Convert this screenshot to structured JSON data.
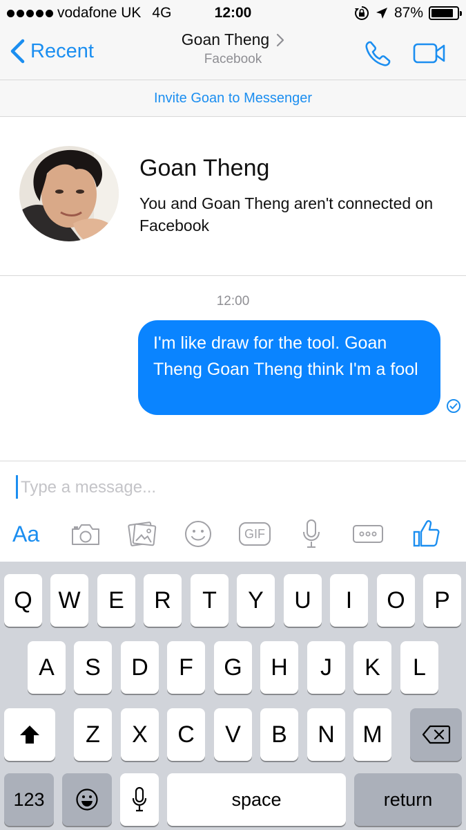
{
  "status_bar": {
    "carrier": "vodafone UK",
    "network": "4G",
    "time": "12:00",
    "battery_percent": "87%",
    "battery_level": 0.87,
    "icons": [
      "signal-dots",
      "rotation-lock-icon",
      "location-arrow-icon",
      "battery-icon"
    ]
  },
  "nav": {
    "back_label": "Recent",
    "title": "Goan Theng",
    "subtitle": "Facebook",
    "icons": [
      "chevron-left-icon",
      "chevron-right-icon",
      "phone-icon",
      "video-camera-icon"
    ],
    "accent_color": "#1b8ef0"
  },
  "invite": {
    "label": "Invite Goan to Messenger"
  },
  "profile": {
    "name": "Goan Theng",
    "description": "You and Goan Theng aren't connected on Facebook"
  },
  "conversation": {
    "timestamp": "12:00",
    "messages": [
      {
        "text": "I'm like draw for the tool. Goan Theng Goan Theng think I'm a fool",
        "sender": "me",
        "bubble_color": "#0a84ff"
      }
    ]
  },
  "composer": {
    "placeholder": "Type a message...",
    "value": "",
    "text_format_label": "Aa",
    "gif_label": "GIF",
    "toolbar_icons": [
      "text-format-icon",
      "camera-icon",
      "photo-gallery-icon",
      "emoji-icon",
      "gif-icon",
      "microphone-icon",
      "more-icon",
      "thumbs-up-icon"
    ]
  },
  "keyboard": {
    "rows": [
      [
        "Q",
        "W",
        "E",
        "R",
        "T",
        "Y",
        "U",
        "I",
        "O",
        "P"
      ],
      [
        "A",
        "S",
        "D",
        "F",
        "G",
        "H",
        "J",
        "K",
        "L"
      ],
      [
        "Z",
        "X",
        "C",
        "V",
        "B",
        "N",
        "M"
      ]
    ],
    "numbers_label": "123",
    "space_label": "space",
    "return_label": "return",
    "special_icons": [
      "shift-icon",
      "backspace-icon",
      "emoji-keyboard-icon",
      "dictation-icon"
    ]
  }
}
